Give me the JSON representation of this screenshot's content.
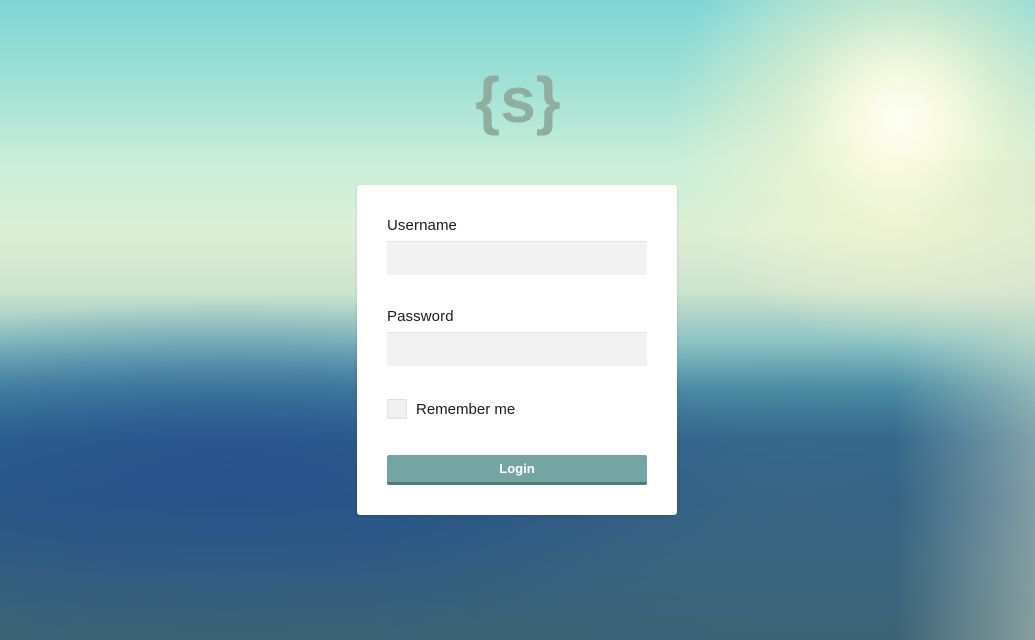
{
  "logo": {
    "text": "{s}",
    "icon": "brand-logo-icon",
    "color": "#8fae9f"
  },
  "form": {
    "username_label": "Username",
    "username_value": "",
    "username_placeholder": "",
    "password_label": "Password",
    "password_value": "",
    "password_placeholder": "",
    "remember_label": "Remember me",
    "remember_checked": false,
    "login_label": "Login"
  },
  "colors": {
    "button": "#75a5a2",
    "button_border": "#4e7b7b",
    "card": "#ffffff",
    "input_bg": "#f2f2f2"
  }
}
